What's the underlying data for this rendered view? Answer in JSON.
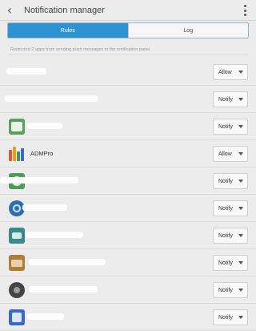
{
  "header": {
    "title": "Notification manager"
  },
  "tabs": [
    {
      "label": "Rules",
      "active": true
    },
    {
      "label": "Log",
      "active": false
    }
  ],
  "info_text": "Restricted 2 apps from sending push messages to the notification panel",
  "apps": [
    {
      "name": "",
      "icon": "blank-app-icon",
      "icon_color": "#ffffff",
      "setting": "Allow"
    },
    {
      "name": "",
      "icon": "blank-app-icon",
      "icon_color": "#ffffff",
      "setting": "Notify"
    },
    {
      "name": "",
      "icon": "green-app-icon",
      "icon_color": "#5aa05a",
      "setting": "Notify"
    },
    {
      "name": "ADMPro",
      "icon": "admpro-app-icon",
      "icon_color": "#d85a3a",
      "setting": "Allow"
    },
    {
      "name": "",
      "icon": "green-app-icon",
      "icon_color": "#4f9a5a",
      "setting": "Notify"
    },
    {
      "name": "",
      "icon": "blue-globe-app-icon",
      "icon_color": "#2d6fb0",
      "setting": "Notify"
    },
    {
      "name": "",
      "icon": "teal-app-icon",
      "icon_color": "#3a8a8a",
      "setting": "Notify"
    },
    {
      "name": "",
      "icon": "brown-app-icon",
      "icon_color": "#b07a3a",
      "setting": "Notify"
    },
    {
      "name": "",
      "icon": "dark-app-icon",
      "icon_color": "#444444",
      "setting": "Notify"
    },
    {
      "name": "",
      "icon": "blue-app-icon",
      "icon_color": "#3a6ac8",
      "setting": "Notify"
    }
  ],
  "colors": {
    "accent": "#2d93d0"
  }
}
